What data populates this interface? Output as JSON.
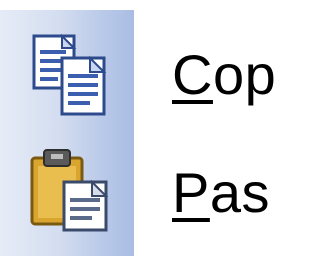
{
  "context_menu": {
    "items": [
      {
        "icon": "copy-icon",
        "label_accel": "C",
        "label_rest": "op"
      },
      {
        "icon": "paste-icon",
        "label_accel": "P",
        "label_rest": "as"
      }
    ]
  },
  "colors": {
    "gutter_light": "#e6ecf7",
    "gutter_dark": "#a9bde3",
    "menu_background": "#ffffff",
    "text": "#000000"
  }
}
